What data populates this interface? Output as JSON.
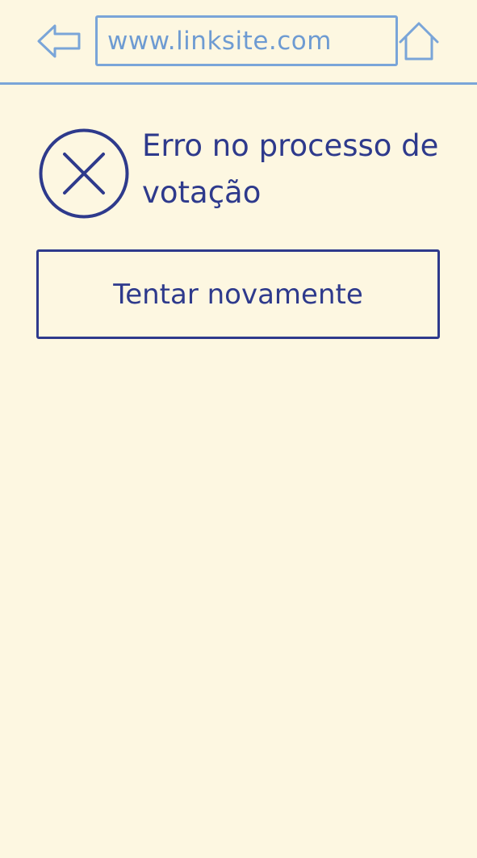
{
  "browser": {
    "url_value": "www.linksite.com"
  },
  "icons": {
    "back": "arrow-left-icon",
    "home": "home-icon",
    "error": "error-circle-x-icon"
  },
  "error": {
    "title": "Erro no processo de votação"
  },
  "actions": {
    "retry_label": "Tentar novamente"
  },
  "colors": {
    "background": "#fdf7e1",
    "primary": "#2e3a8c",
    "accent": "#7aa5d8"
  }
}
